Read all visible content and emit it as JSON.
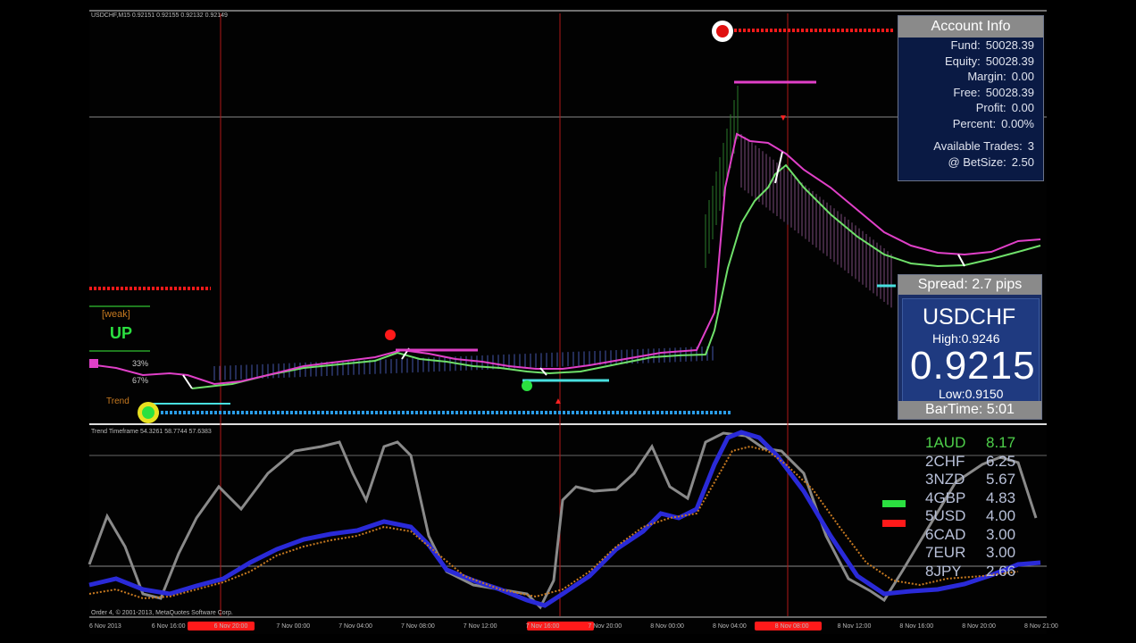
{
  "window": {
    "title_main": "USDCHF,M15  0.92151 0.92155 0.92132 0.92149",
    "title_sub": "Trend Timeframe 54.3261 58.7744 57.6383",
    "copyright": "Order 4, © 2001-2013, MetaQuotes Software Corp."
  },
  "left_signals": {
    "weak": "[weak]",
    "direction": "UP",
    "trend": "Trend",
    "pct_a": "33%",
    "pct_b": "67%"
  },
  "account_info": {
    "title": "Account Info",
    "fund_label": "Fund:",
    "fund_value": "50028.39",
    "equity_label": "Equity:",
    "equity_value": "50028.39",
    "margin_label": "Margin:",
    "margin_value": "0.00",
    "free_label": "Free:",
    "free_value": "50028.39",
    "profit_label": "Profit:",
    "profit_value": "0.00",
    "percent_label": "Percent:",
    "percent_value": "0.00%",
    "trades_label": "Available Trades:",
    "trades_value": "3",
    "betsize_label": "@ BetSize:",
    "betsize_value": "2.50"
  },
  "spread_panel": {
    "spread": "Spread: 2.7 pips",
    "symbol": "USDCHF",
    "high": "High:0.9246",
    "price": "0.9215",
    "low": "Low:0.9150",
    "bartime": "BarTime: 5:01"
  },
  "currency_strength": [
    {
      "name": "1AUD",
      "value": "8.17",
      "color": "#4ecf4a"
    },
    {
      "name": "2CHF",
      "value": "6.25",
      "color": "#b8c0d8"
    },
    {
      "name": "3NZD",
      "value": "5.67",
      "color": "#b8c0d8"
    },
    {
      "name": "4GBP",
      "value": "4.83",
      "color": "#b8c0d8"
    },
    {
      "name": "5USD",
      "value": "4.00",
      "color": "#b8c0d8"
    },
    {
      "name": "6CAD",
      "value": "3.00",
      "color": "#b8c0d8"
    },
    {
      "name": "7EUR",
      "value": "3.00",
      "color": "#b8c0d8"
    },
    {
      "name": "8JPY",
      "value": "2.66",
      "color": "#b8c0d8"
    }
  ],
  "time_axis": [
    "6 Nov 2013",
    "6 Nov 16:00",
    "6 Nov 20:00",
    "7 Nov 00:00",
    "7 Nov 04:00",
    "7 Nov 08:00",
    "7 Nov 12:00",
    "7 Nov 16:00",
    "7 Nov 20:00",
    "8 Nov 00:00",
    "8 Nov 04:00",
    "8 Nov 08:00",
    "8 Nov 12:00",
    "8 Nov 16:00",
    "8 Nov 20:00",
    "8 Nov 21:00"
  ],
  "colors": {
    "ma_magenta": "#e040c8",
    "ma_green": "#6fe06a",
    "signal_red": "#ff1a1a",
    "dotted_blue": "#2a9de8",
    "cyan": "#48e0e0",
    "grey_line": "#8a8a8a",
    "blue_line": "#2a2ad8",
    "orange_dotted": "#c87a20"
  },
  "icons": {
    "sell_signal": "sun-marker-icon",
    "buy_signal": "green-sun-marker-icon",
    "legend_green": "green-bar-icon",
    "legend_red": "red-bar-icon"
  }
}
